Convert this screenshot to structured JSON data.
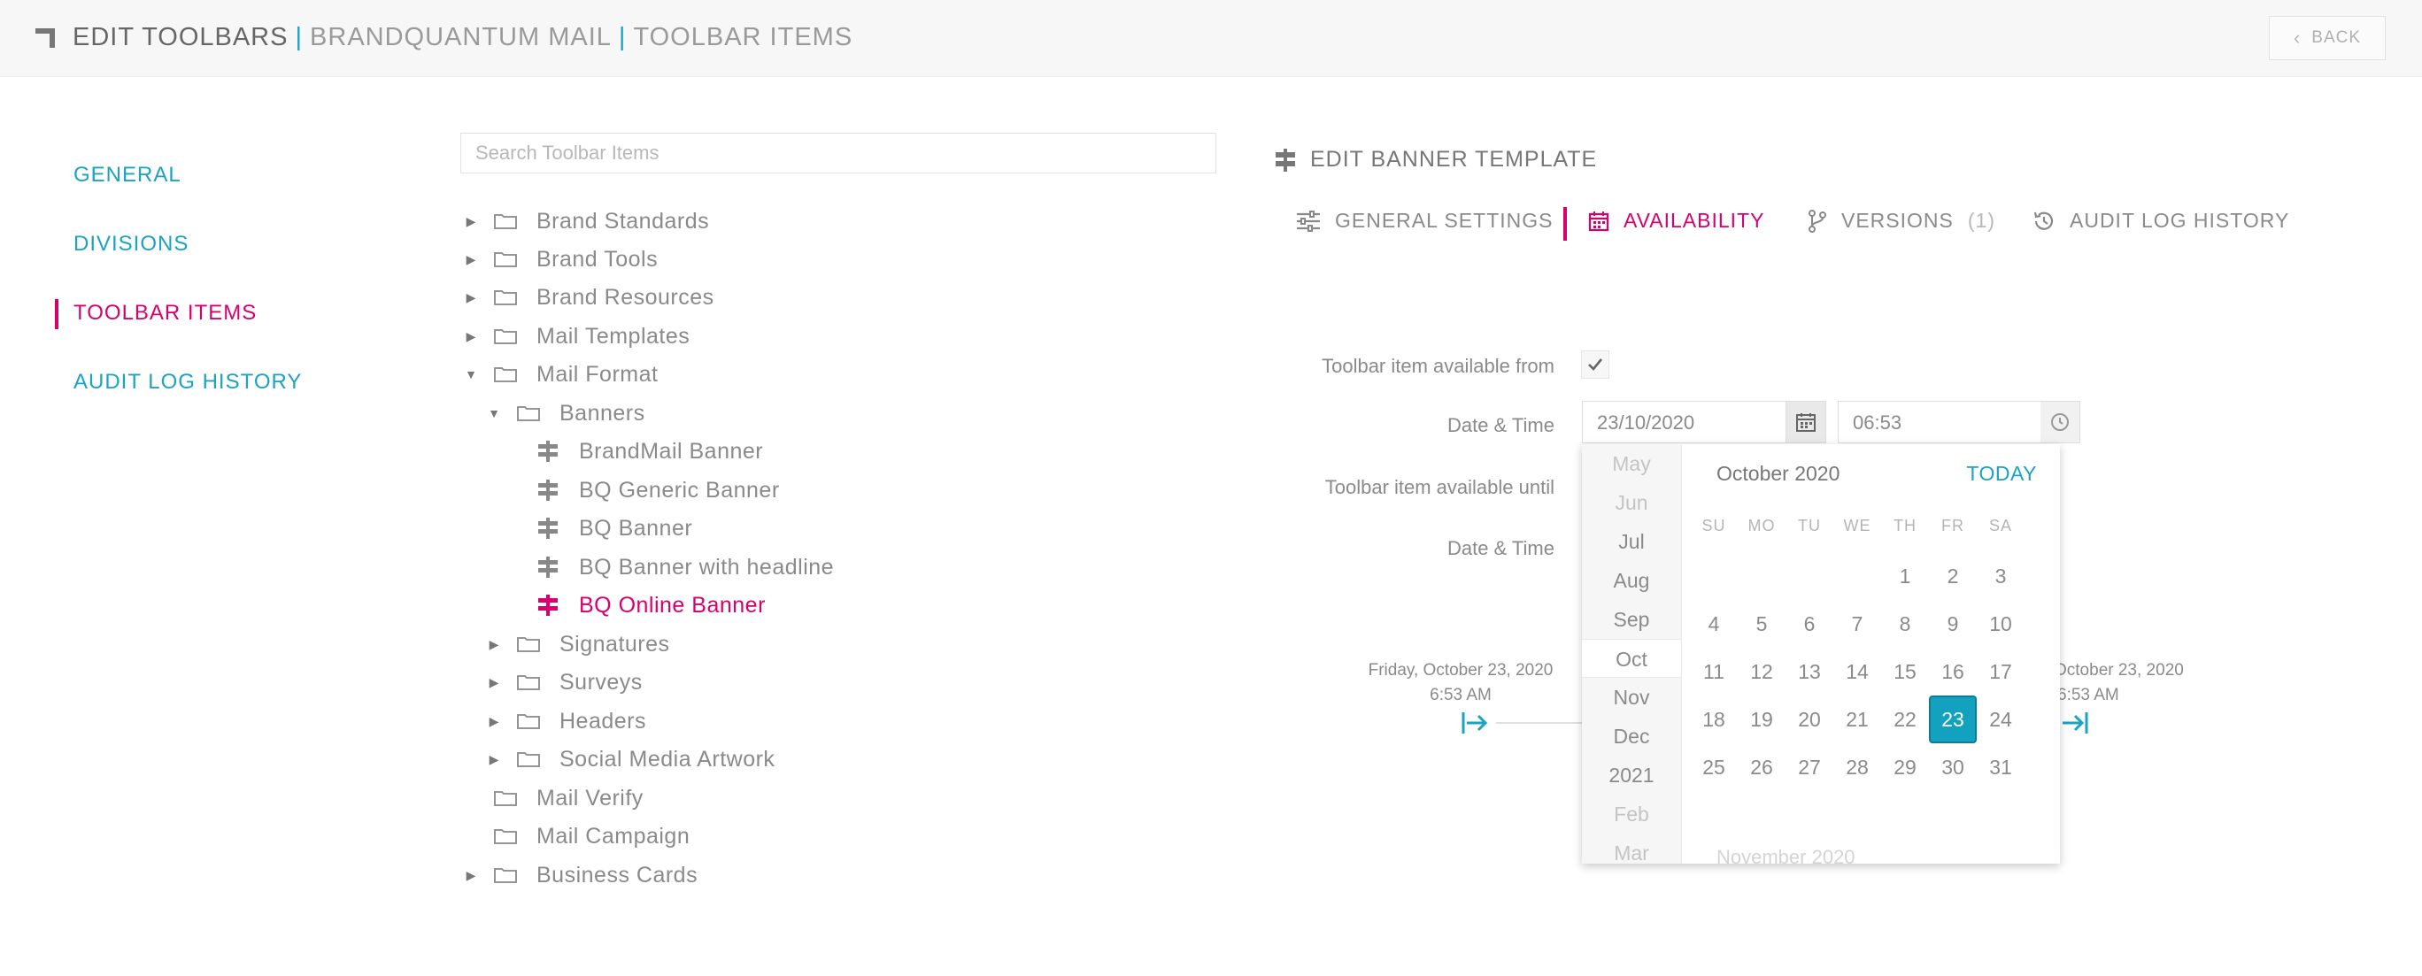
{
  "header": {
    "title_main": "EDIT TOOLBARS",
    "separator": "|",
    "title_company": "BRANDQUANTUM MAIL",
    "title_section": "TOOLBAR ITEMS",
    "back_label": "BACK"
  },
  "sidebar": {
    "items": [
      {
        "label": "GENERAL",
        "active": false
      },
      {
        "label": "DIVISIONS",
        "active": false
      },
      {
        "label": "TOOLBAR ITEMS",
        "active": true
      },
      {
        "label": "AUDIT LOG HISTORY",
        "active": false
      }
    ]
  },
  "search": {
    "placeholder": "Search Toolbar Items",
    "value": ""
  },
  "tree": {
    "nodes": [
      {
        "label": "Brand Standards",
        "type": "folder",
        "state": "collapsed"
      },
      {
        "label": "Brand Tools",
        "type": "folder",
        "state": "collapsed"
      },
      {
        "label": "Brand Resources",
        "type": "folder",
        "state": "collapsed"
      },
      {
        "label": "Mail Templates",
        "type": "folder",
        "state": "collapsed"
      },
      {
        "label": "Mail Format",
        "type": "folder",
        "state": "expanded"
      },
      {
        "label": "Banners",
        "type": "folder",
        "state": "expanded"
      },
      {
        "label": "BrandMail Banner",
        "type": "item"
      },
      {
        "label": "BQ Generic Banner",
        "type": "item"
      },
      {
        "label": "BQ Banner",
        "type": "item"
      },
      {
        "label": "BQ Banner with headline",
        "type": "item"
      },
      {
        "label": "BQ Online Banner",
        "type": "item",
        "selected": true
      },
      {
        "label": "Signatures",
        "type": "folder",
        "state": "collapsed"
      },
      {
        "label": "Surveys",
        "type": "folder",
        "state": "collapsed"
      },
      {
        "label": "Headers",
        "type": "folder",
        "state": "collapsed"
      },
      {
        "label": "Social Media Artwork",
        "type": "folder",
        "state": "collapsed"
      },
      {
        "label": "Mail Verify",
        "type": "folder",
        "state": "leaf"
      },
      {
        "label": "Mail Campaign",
        "type": "folder",
        "state": "leaf"
      },
      {
        "label": "Business Cards",
        "type": "folder",
        "state": "collapsed"
      }
    ]
  },
  "panel": {
    "title": "EDIT BANNER TEMPLATE",
    "tabs": [
      {
        "label": "GENERAL SETTINGS",
        "icon": "sliders-icon",
        "active": false
      },
      {
        "label": "AVAILABILITY",
        "icon": "calendar-icon",
        "active": true
      },
      {
        "label": "VERSIONS",
        "count": "(1)",
        "icon": "branch-icon",
        "active": false
      },
      {
        "label": "AUDIT LOG HISTORY",
        "icon": "history-icon",
        "active": false
      }
    ],
    "form": {
      "available_from_label": "Toolbar item available from",
      "available_from_checked": true,
      "date_time_label": "Date & Time",
      "date_value": "23/10/2020",
      "time_value": "06:53",
      "available_until_label": "Toolbar item available until",
      "date_time_label_2": "Date & Time"
    },
    "timeline": {
      "start_date": "Friday, October 23, 2020",
      "start_time": "6:53 AM",
      "end_date": "October 23, 2020",
      "end_time": "6:53 AM"
    }
  },
  "calendar": {
    "months": [
      "May",
      "Jun",
      "Jul",
      "Aug",
      "Sep",
      "Oct",
      "Nov",
      "Dec",
      "2021",
      "Feb",
      "Mar"
    ],
    "current_month_index": 5,
    "title": "October 2020",
    "today_label": "TODAY",
    "weekdays": [
      "SU",
      "MO",
      "TU",
      "WE",
      "TH",
      "FR",
      "SA"
    ],
    "weeks": [
      [
        "",
        "",
        "",
        "",
        "1",
        "2",
        "3"
      ],
      [
        "4",
        "5",
        "6",
        "7",
        "8",
        "9",
        "10"
      ],
      [
        "11",
        "12",
        "13",
        "14",
        "15",
        "16",
        "17"
      ],
      [
        "18",
        "19",
        "20",
        "21",
        "22",
        "23",
        "24"
      ],
      [
        "25",
        "26",
        "27",
        "28",
        "29",
        "30",
        "31"
      ]
    ],
    "selected_day": "23",
    "next_month_label": "November 2020"
  },
  "colors": {
    "accent_teal": "#1aa3c2",
    "accent_magenta": "#d8006e",
    "selected_day_bg": "#12a2c0"
  }
}
